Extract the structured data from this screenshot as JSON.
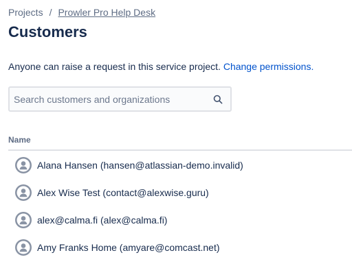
{
  "breadcrumb": {
    "root": "Projects",
    "separator": "/",
    "project": "Prowler Pro Help Desk"
  },
  "page": {
    "title": "Customers"
  },
  "description": {
    "text": "Anyone can raise a request in this service project.",
    "link": "Change permissions."
  },
  "search": {
    "placeholder": "Search customers and organizations",
    "value": "",
    "icon": "search-icon"
  },
  "table": {
    "columns": [
      "Name"
    ],
    "rows": [
      {
        "label": "Alana Hansen (hansen@atlassian-demo.invalid)",
        "icon": "user-avatar-icon"
      },
      {
        "label": "Alex Wise Test (contact@alexwise.guru)",
        "icon": "user-avatar-icon"
      },
      {
        "label": "alex@calma.fi (alex@calma.fi)",
        "icon": "user-avatar-icon"
      },
      {
        "label": "Amy Franks Home (amyare@comcast.net)",
        "icon": "user-avatar-icon"
      }
    ]
  },
  "colors": {
    "link": "#0052cc",
    "text": "#172b4d",
    "subtle": "#5e6c84",
    "border": "#dfe1e6",
    "avatar": "#8993a4"
  }
}
